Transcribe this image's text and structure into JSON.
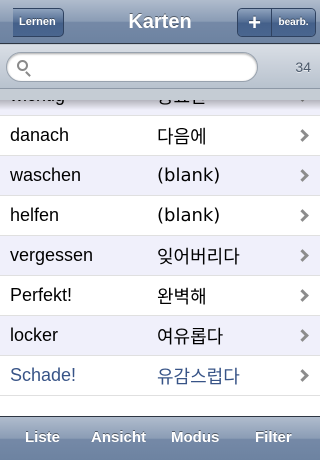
{
  "navbar": {
    "back_label": "Lernen",
    "title": "Karten",
    "add_label": "+",
    "edit_label": "bearb."
  },
  "search": {
    "placeholder": "",
    "value": "",
    "count": "34"
  },
  "list": {
    "rows": [
      {
        "de": "wichtig",
        "ko": "중요한"
      },
      {
        "de": "danach",
        "ko": "다음에"
      },
      {
        "de": "waschen",
        "ko": "(blank)"
      },
      {
        "de": "helfen",
        "ko": "(blank)"
      },
      {
        "de": "vergessen",
        "ko": "잊어버리다"
      },
      {
        "de": "Perfekt!",
        "ko": "완벽해"
      },
      {
        "de": "locker",
        "ko": "여유롭다"
      },
      {
        "de": "Schade!",
        "ko": "유감스럽다"
      }
    ],
    "highlight_color": "#385487"
  },
  "toolbar": {
    "list_label": "Liste",
    "view_label": "Ansicht",
    "mode_label": "Modus",
    "filter_label": "Filter"
  }
}
